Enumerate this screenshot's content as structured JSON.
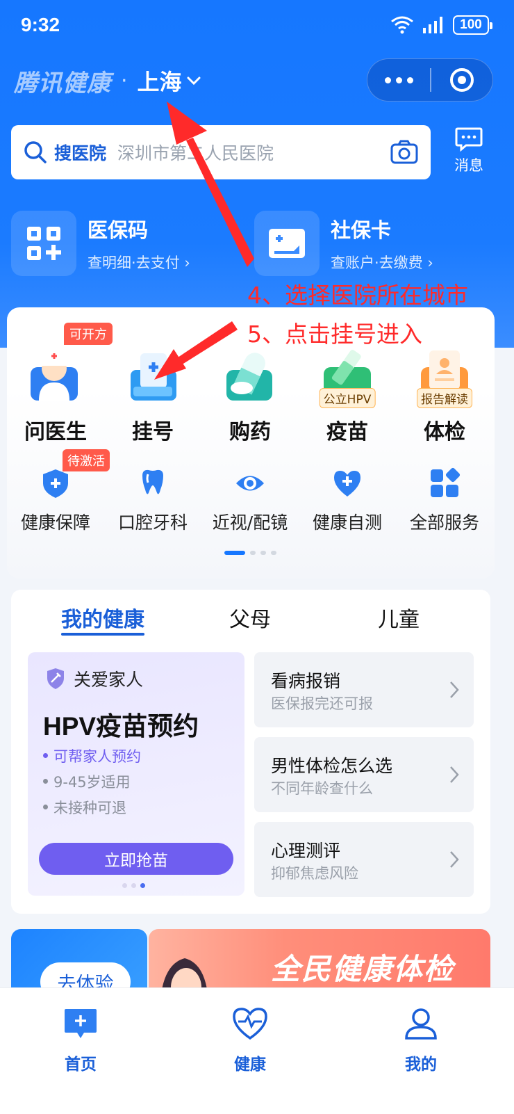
{
  "status_bar": {
    "time": "9:32",
    "battery": "100"
  },
  "header": {
    "brand": "腾讯健康",
    "separator": "·",
    "city": "上海"
  },
  "search": {
    "label": "搜医院",
    "placeholder": "深圳市第二人民医院"
  },
  "message": {
    "label": "消息"
  },
  "quick_cards": [
    {
      "title": "医保码",
      "subtitle": "查明细·去支付"
    },
    {
      "title": "社保卡",
      "subtitle": "查账户·去缴费"
    }
  ],
  "services_main": [
    {
      "label": "问医生",
      "badge": "可开方"
    },
    {
      "label": "挂号"
    },
    {
      "label": "购药"
    },
    {
      "label": "疫苗",
      "tag": "公立HPV"
    },
    {
      "label": "体检",
      "tag": "报告解读"
    }
  ],
  "services_sub": [
    {
      "label": "健康保障",
      "badge": "待激活"
    },
    {
      "label": "口腔牙科"
    },
    {
      "label": "近视/配镜"
    },
    {
      "label": "健康自测"
    },
    {
      "label": "全部服务"
    }
  ],
  "health": {
    "tabs": [
      "我的健康",
      "父母",
      "儿童"
    ],
    "promo": {
      "head": "关爱家人",
      "title": "HPV疫苗预约",
      "bullets": [
        "可帮家人预约",
        "9-45岁适用",
        "未接种可退"
      ],
      "button": "立即抢苗"
    },
    "items": [
      {
        "title": "看病报销",
        "subtitle": "医保报完还可报"
      },
      {
        "title": "男性体检怎么选",
        "subtitle": "不同年龄查什么"
      },
      {
        "title": "心理测评",
        "subtitle": "抑郁焦虑风险"
      }
    ]
  },
  "banners": {
    "left_button": "去体验",
    "right_text": "全民健康体检"
  },
  "bottom_nav": [
    "首页",
    "健康",
    "我的"
  ],
  "annotations": {
    "step4": "4、选择医院所在城市",
    "step5": "5、点击挂号进入"
  },
  "colors": {
    "primary": "#1677ff",
    "accent_red": "#ff2a2a",
    "promo_purple": "#6f5ef0"
  }
}
